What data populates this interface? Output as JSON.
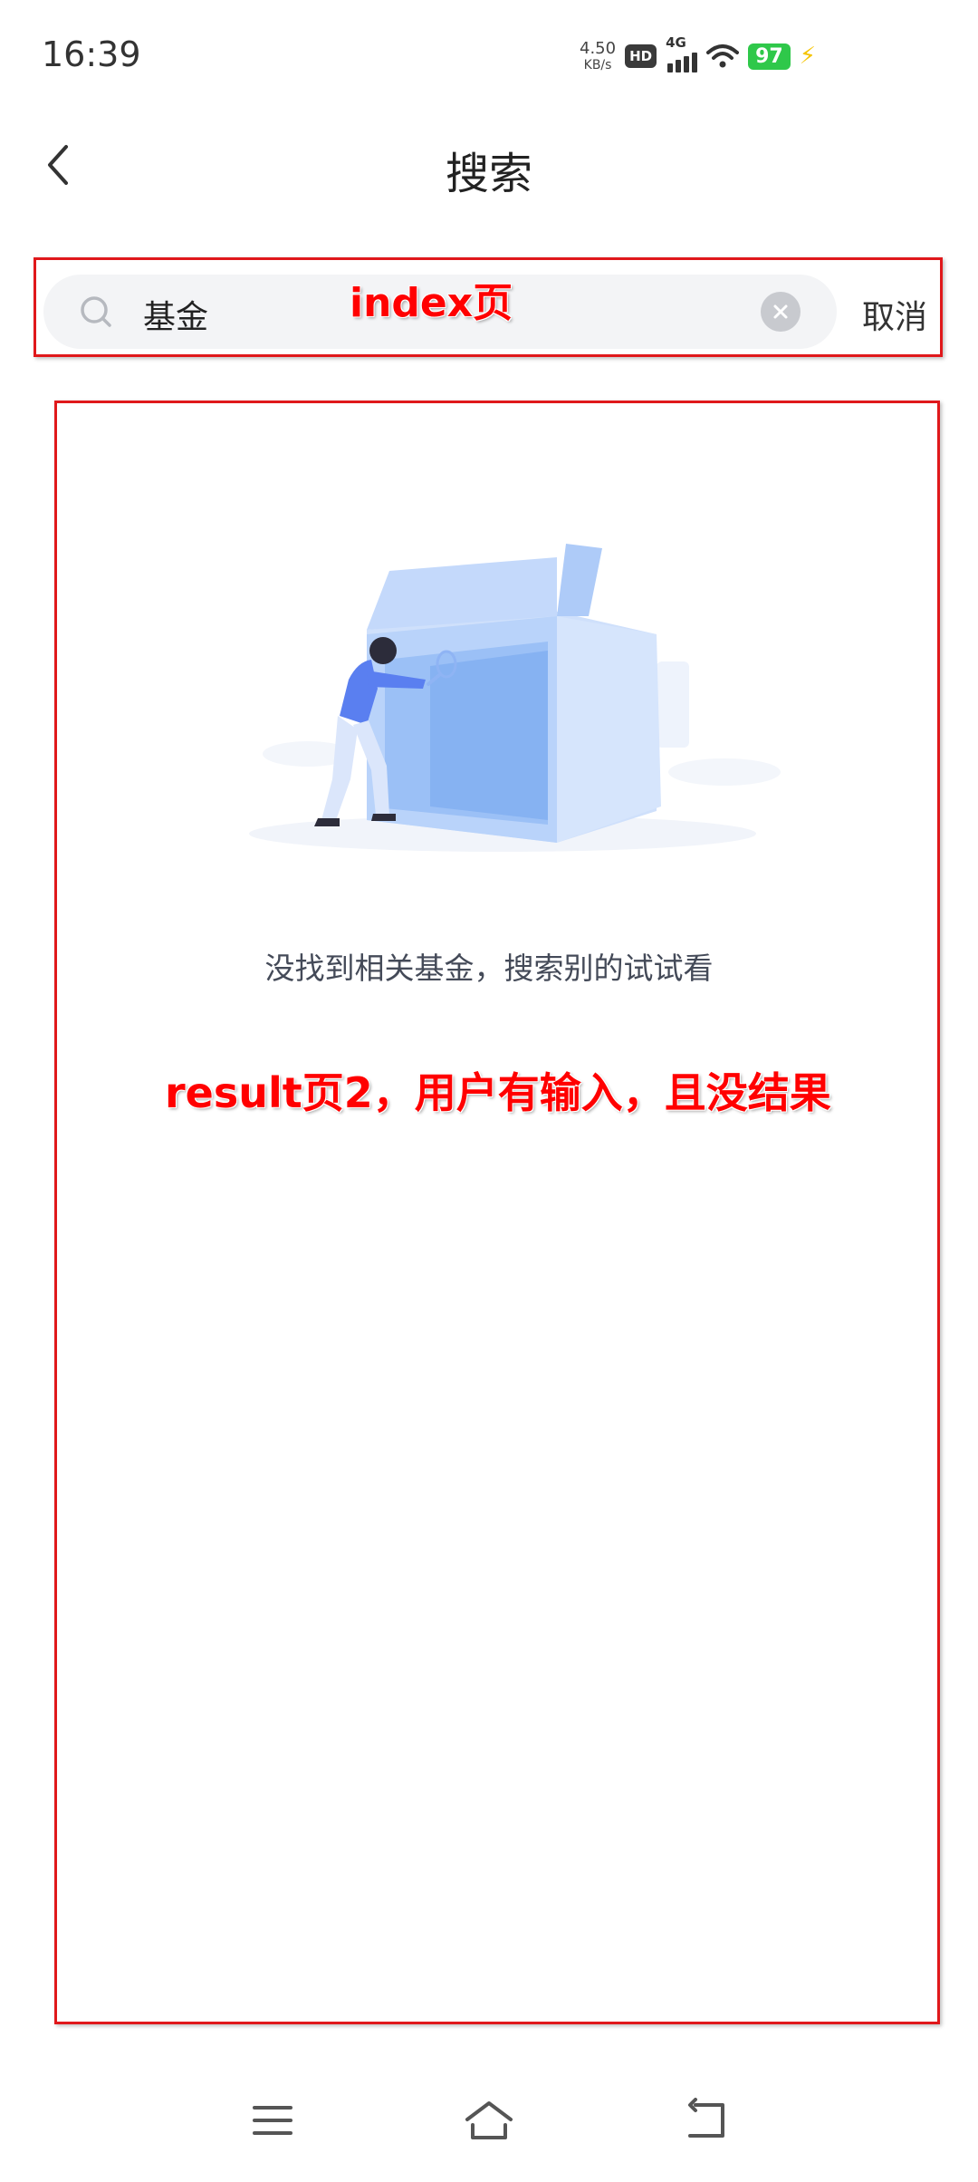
{
  "status_bar": {
    "time": "16:39",
    "net_speed_value": "4.50",
    "net_speed_unit": "KB/s",
    "hd_label": "HD",
    "network_label": "4G",
    "battery_level": "97",
    "colors": {
      "battery": "#2fc84a",
      "charging_bolt": "#f5c400"
    }
  },
  "header": {
    "title": "搜索",
    "back_icon": "chevron-left-icon"
  },
  "search": {
    "value": "基金",
    "search_icon": "search-icon",
    "clear_icon": "clear-circle-icon",
    "cancel_label": "取消"
  },
  "empty_state": {
    "illustration": "person-searching-box-illustration",
    "message": "没找到相关基金，搜索别的试试看"
  },
  "annotations": {
    "search_area_label": "index页",
    "result_area_label": "result页2，用户有输入，且没结果",
    "color": "#e0181b"
  },
  "nav_bar": {
    "menu_icon": "menu-icon",
    "home_icon": "home-icon",
    "back_icon": "back-arrow-icon"
  }
}
